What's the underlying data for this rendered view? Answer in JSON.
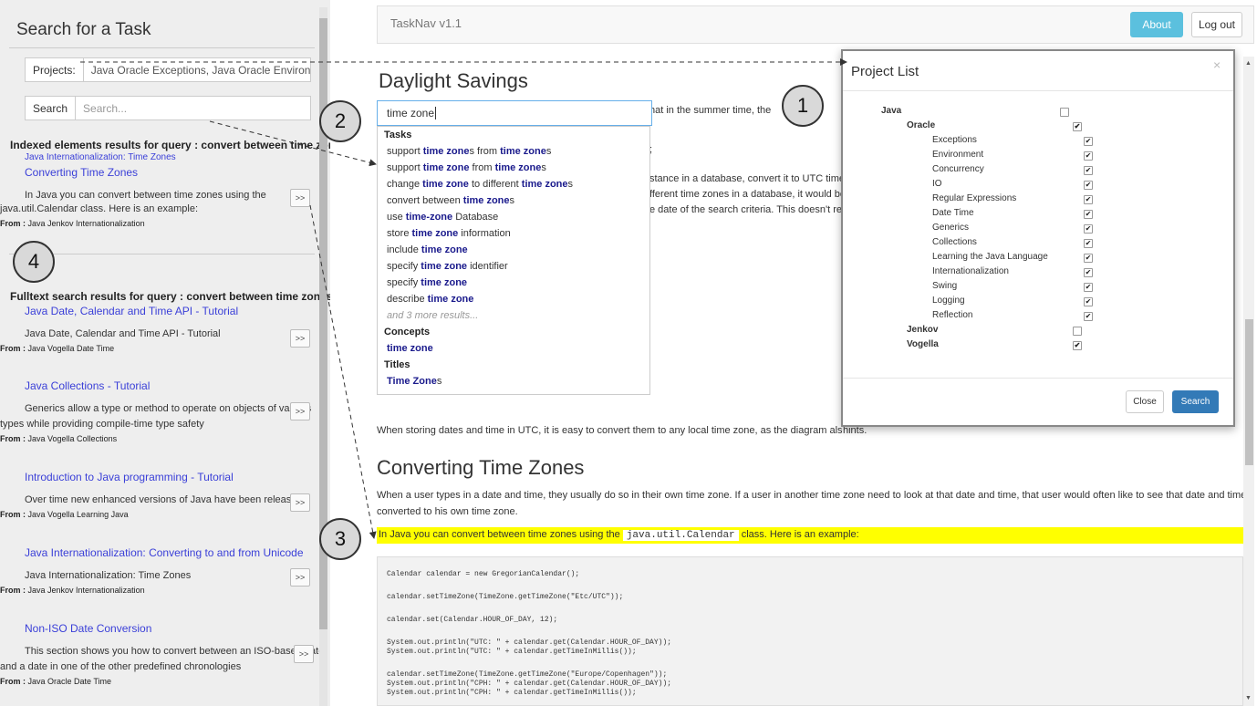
{
  "sidebar": {
    "title": "Search for a Task",
    "projects_label": "Projects:",
    "projects_value": "Java Oracle Exceptions, Java Oracle Environment,",
    "search_button": "Search",
    "search_placeholder": "Search...",
    "indexed": {
      "heading": "Indexed elements results for query : convert between time zones",
      "breadcrumb": "Java Internationalization: Time Zones",
      "title": "Converting Time Zones",
      "text1": "In Java you can convert between time zones using the",
      "text2": "java.util.Calendar class. Here is an example:",
      "from_label": "From :",
      "from_value": "Java Jenkov Internationalization",
      "go": ">>"
    },
    "fulltext_heading": "Fulltext search results for query : convert between time zones",
    "results": [
      {
        "title": "Java Date, Calendar and Time API - Tutorial",
        "text1": "Java Date, Calendar and Time API - Tutorial",
        "text2": "",
        "from_label": "From :",
        "from": "Java Vogella Date Time",
        "go": ">>"
      },
      {
        "title": "Java Collections - Tutorial",
        "text1": "Generics allow a type or method to operate on objects of various",
        "text2": "types while providing compile-time type safety",
        "from_label": "From :",
        "from": "Java Vogella Collections",
        "go": ">>"
      },
      {
        "title": "Introduction to Java programming - Tutorial",
        "text1": "Over time new enhanced versions of Java have been released",
        "text2": "",
        "from_label": "From :",
        "from": "Java Vogella Learning Java",
        "go": ">>"
      },
      {
        "title": "Java Internationalization: Converting to and from Unicode",
        "text1": "Java Internationalization: Time Zones",
        "text2": "",
        "from_label": "From :",
        "from": "Java Jenkov Internationalization",
        "go": ">>"
      },
      {
        "title": "Non-ISO Date Conversion",
        "text1": "This section shows you how to convert between an ISO-based date",
        "text2": "and a date in one of the other predefined chronologies",
        "from_label": "From :",
        "from": "Java Oracle Date Time",
        "go": ">>"
      }
    ]
  },
  "topbar": {
    "app_title": "TaskNav v1.1",
    "about": "About",
    "logout": "Log out"
  },
  "main": {
    "heading1": "Daylight Savings",
    "search_value": "time zone",
    "partial1": "hat in the summer time, the",
    "partial2": ";",
    "partial3": "stance in a database, convert it to UTC time",
    "partial4": "fferent time zones in a database, it would be",
    "partial5": "e date of the search criteria. This doesn't rea",
    "para_utc": "When storing dates and time in UTC, it is easy to convert them to any local time zone, as the diagram also hints.",
    "heading2": "Converting Time Zones",
    "para2a": "When a user types in a date and time, they usually do so in their own time zone. If a user in another time zone need to look at that date and time, that user would often like to see that date and time",
    "para2b": "converted to his own time zone.",
    "hl_before": "In Java you can convert between time zones using the ",
    "hl_code": "java.util.Calendar",
    "hl_after": " class. Here is an example:",
    "code": [
      "Calendar calendar = new GregorianCalendar();",
      "",
      "calendar.setTimeZone(TimeZone.getTimeZone(\"Etc/UTC\"));",
      "",
      "calendar.set(Calendar.HOUR_OF_DAY, 12);",
      "",
      "System.out.println(\"UTC: \" + calendar.get(Calendar.HOUR_OF_DAY));",
      "System.out.println(\"UTC: \" + calendar.getTimeInMillis());",
      "",
      "calendar.setTimeZone(TimeZone.getTimeZone(\"Europe/Copenhagen\"));",
      "System.out.println(\"CPH: \" + calendar.get(Calendar.HOUR_OF_DAY));",
      "System.out.println(\"CPH: \" + calendar.getTimeInMillis());"
    ]
  },
  "dropdown": {
    "tasks_header": "Tasks",
    "tasks": [
      [
        "support ",
        "time zone",
        "s from ",
        "time zone",
        "s"
      ],
      [
        "support ",
        "time zone",
        " from ",
        "time zone",
        "s"
      ],
      [
        "change ",
        "time zone",
        " to different ",
        "time zone",
        "s"
      ],
      [
        "convert  between ",
        "time zone",
        "s",
        "",
        ""
      ],
      [
        "use ",
        "time-zone",
        " Database",
        "",
        ""
      ],
      [
        "store ",
        "time zone",
        " information",
        "",
        ""
      ],
      [
        "include ",
        "time zone",
        "",
        "",
        ""
      ],
      [
        "specify ",
        "time zone",
        " identifier",
        "",
        ""
      ],
      [
        "specify ",
        "time zone",
        "",
        "",
        ""
      ],
      [
        "describe ",
        "time zone",
        "",
        "",
        ""
      ]
    ],
    "more": "and 3 more results...",
    "concepts_header": "Concepts",
    "concept": "time zone",
    "titles_header": "Titles",
    "title_bold": "Time Zone",
    "title_rest": "s"
  },
  "modal": {
    "title": "Project List",
    "close_x": "×",
    "tree": [
      {
        "label": "Java",
        "level": 0,
        "bold": true,
        "checked": false
      },
      {
        "label": "Oracle",
        "level": 1,
        "bold": true,
        "checked": true
      },
      {
        "label": "Exceptions",
        "level": 2,
        "bold": false,
        "checked": true
      },
      {
        "label": "Environment",
        "level": 2,
        "bold": false,
        "checked": true
      },
      {
        "label": "Concurrency",
        "level": 2,
        "bold": false,
        "checked": true
      },
      {
        "label": "IO",
        "level": 2,
        "bold": false,
        "checked": true
      },
      {
        "label": "Regular Expressions",
        "level": 2,
        "bold": false,
        "checked": true
      },
      {
        "label": "Date Time",
        "level": 2,
        "bold": false,
        "checked": true
      },
      {
        "label": "Generics",
        "level": 2,
        "bold": false,
        "checked": true
      },
      {
        "label": "Collections",
        "level": 2,
        "bold": false,
        "checked": true
      },
      {
        "label": "Learning the Java Language",
        "level": 2,
        "bold": false,
        "checked": true
      },
      {
        "label": "Internationalization",
        "level": 2,
        "bold": false,
        "checked": true
      },
      {
        "label": "Swing",
        "level": 2,
        "bold": false,
        "checked": true
      },
      {
        "label": "Logging",
        "level": 2,
        "bold": false,
        "checked": true
      },
      {
        "label": "Reflection",
        "level": 2,
        "bold": false,
        "checked": true
      },
      {
        "label": "Jenkov",
        "level": 1,
        "bold": true,
        "checked": false
      },
      {
        "label": "Vogella",
        "level": 1,
        "bold": true,
        "checked": true
      }
    ],
    "close_btn": "Close",
    "search_btn": "Search"
  },
  "callouts": [
    "1",
    "2",
    "3",
    "4"
  ],
  "colors": {
    "highlight": "#ffff00",
    "about": "#5bc0de",
    "search": "#337ab7",
    "link": "#3a3fd8"
  }
}
